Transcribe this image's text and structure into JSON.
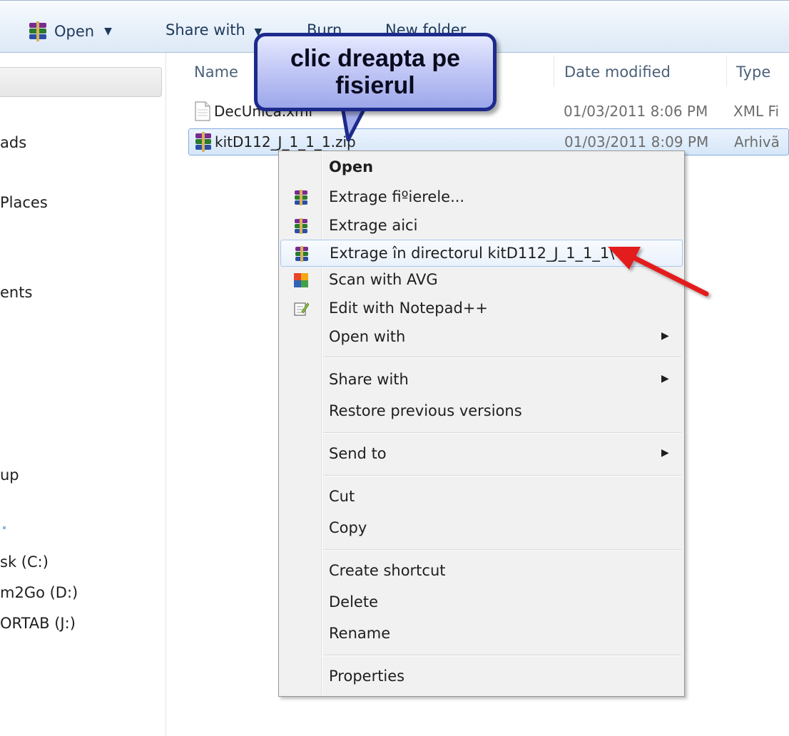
{
  "toolbar": {
    "open_label": "Open",
    "share_label": "Share with",
    "burn_label": "Burn",
    "newfolder_label": "New folder"
  },
  "nav": {
    "items": [
      {
        "label": "ads"
      },
      {
        "label": "Places"
      },
      {
        "label": "ents"
      },
      {
        "label": "up"
      },
      {
        "label": "sk (C:)"
      },
      {
        "label": "m2Go (D:)"
      },
      {
        "label": "ORTAB (J:)"
      }
    ]
  },
  "columns": {
    "name": "Name",
    "date": "Date modified",
    "type": "Type"
  },
  "files": [
    {
      "name": "DecUnica.xml",
      "date": "01/03/2011 8:06 PM",
      "type": "XML Fi"
    },
    {
      "name": "kitD112_J_1_1_1.zip",
      "date": "01/03/2011 8:09 PM",
      "type": "Arhivã"
    }
  ],
  "callout": {
    "line1": "clic dreapta pe",
    "line2": "fisierul"
  },
  "menu": {
    "open": "Open",
    "extract_files": "Extrage fiºierele...",
    "extract_here": "Extrage aici",
    "extract_to": "Extrage în directorul kitD112_J_1_1_1\\",
    "scan_avg": "Scan with AVG",
    "edit_notepad": "Edit with Notepad++",
    "open_with": "Open with",
    "share_with": "Share with",
    "restore": "Restore previous versions",
    "send_to": "Send to",
    "cut": "Cut",
    "copy": "Copy",
    "create_shortcut": "Create shortcut",
    "delete": "Delete",
    "rename": "Rename",
    "properties": "Properties"
  },
  "colors": {
    "accent": "#3399ff",
    "callout_border": "#1d2a8c",
    "annotation_arrow": "#e31b1b"
  }
}
